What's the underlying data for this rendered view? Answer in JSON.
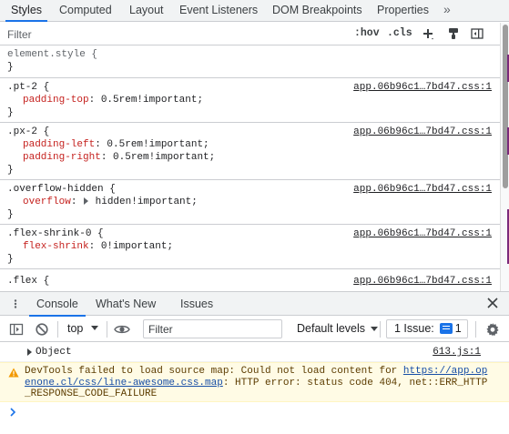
{
  "devtools": {
    "tabs": [
      {
        "label": "Styles",
        "active": true
      },
      {
        "label": "Computed"
      },
      {
        "label": "Layout"
      },
      {
        "label": "Event Listeners"
      },
      {
        "label": "DOM Breakpoints"
      },
      {
        "label": "Properties"
      }
    ],
    "more_tabs_label": "»",
    "styles_filter": {
      "placeholder": "Filter",
      "hov_label": ":hov",
      "cls_label": ".cls",
      "icons": [
        "plus-icon",
        "paint-brush-icon",
        "toggle-sidebar-icon"
      ]
    },
    "rules": [
      {
        "selector": "element.style {",
        "close": "}",
        "source": "",
        "props": []
      },
      {
        "selector": ".pt-2 {",
        "close": "}",
        "source": "app.06b96c1…7bd47.css:1",
        "props": [
          {
            "name": "padding-top",
            "value": "0.5rem!important;"
          }
        ]
      },
      {
        "selector": ".px-2 {",
        "close": "}",
        "source": "app.06b96c1…7bd47.css:1",
        "props": [
          {
            "name": "padding-left",
            "value": "0.5rem!important;"
          },
          {
            "name": "padding-right",
            "value": "0.5rem!important;"
          }
        ]
      },
      {
        "selector": ".overflow-hidden {",
        "close": "}",
        "source": "app.06b96c1…7bd47.css:1",
        "props": [
          {
            "name": "overflow",
            "value": "hidden!important;",
            "expandable": true
          }
        ]
      },
      {
        "selector": ".flex-shrink-0 {",
        "close": "}",
        "source": "app.06b96c1…7bd47.css:1",
        "props": [
          {
            "name": "flex-shrink",
            "value": "0!important;"
          }
        ]
      },
      {
        "selector": ".flex {",
        "close": "",
        "source": "app.06b96c1…7bd47.css:1",
        "props": []
      }
    ],
    "drawer": {
      "tabs": [
        {
          "label": "Console",
          "active": true
        },
        {
          "label": "What's New"
        },
        {
          "label": "Issues"
        }
      ],
      "close_icon": "close-icon",
      "toolbar": {
        "context": "top",
        "filter_placeholder": "Filter",
        "levels_label": "Default levels",
        "issues_label": "1 Issue:",
        "issues_count": "1"
      },
      "messages": {
        "object_label": "Object",
        "object_source": "613.js:1",
        "warning_prefix": "DevTools failed to load source map: Could not load content for ",
        "warning_url": "https://app.openone.cl/css/line-awesome.css.map",
        "warning_suffix": ": HTTP error: status code 404, net::ERR_HTTP_RESPONSE_CODE_FAILURE"
      }
    },
    "colors": {
      "accent": "#1a73e8",
      "property": "#c5221f",
      "warning_bg": "#fffbe5",
      "warning_text": "#5c3c00"
    }
  }
}
